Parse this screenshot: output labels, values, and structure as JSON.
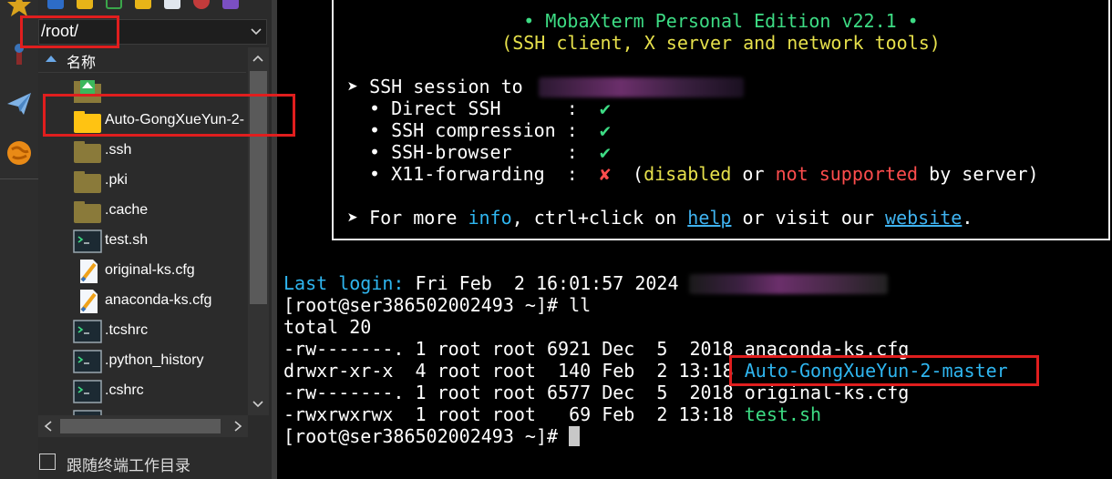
{
  "file_browser": {
    "path": "/root/",
    "column_header": "名称",
    "follow_terminal_label": "跟随终端工作目录",
    "files": [
      {
        "name": "",
        "type": "parent-folder-icon"
      },
      {
        "name": "Auto-GongXueYun-2-",
        "type": "folder-icon"
      },
      {
        "name": ".ssh",
        "type": "folder-icon"
      },
      {
        "name": ".pki",
        "type": "folder-icon"
      },
      {
        "name": ".cache",
        "type": "folder-icon"
      },
      {
        "name": "test.sh",
        "type": "script-icon"
      },
      {
        "name": "original-ks.cfg",
        "type": "config-file-icon"
      },
      {
        "name": "anaconda-ks.cfg",
        "type": "config-file-icon"
      },
      {
        "name": ".tcshrc",
        "type": "script-icon"
      },
      {
        "name": ".python_history",
        "type": "script-icon"
      },
      {
        "name": ".cshrc",
        "type": "script-icon"
      }
    ]
  },
  "banner": {
    "title_line": "• MobaXterm Personal Edition v22.1 •",
    "subtitle_line": "(SSH client, X server and network tools)",
    "session_prefix": "➤ SSH session to",
    "features": [
      {
        "label": "• Direct SSH      :",
        "mark": "✔",
        "ok": true
      },
      {
        "label": "• SSH compression :",
        "mark": "✔",
        "ok": true
      },
      {
        "label": "• SSH-browser     :",
        "mark": "✔",
        "ok": true
      },
      {
        "label": "• X11-forwarding  :",
        "mark": "✘",
        "ok": false
      }
    ],
    "x11_note": {
      "open": "(",
      "disabled": "disabled",
      "or": " or ",
      "not_supported": "not supported",
      "tail": " by server)"
    },
    "more_info": {
      "prefix": "➤ For more ",
      "info": "info",
      "mid1": ", ctrl+click on ",
      "help": "help",
      "mid2": " or visit our ",
      "website": "website",
      "end": "."
    }
  },
  "terminal": {
    "last_login_label": "Last login:",
    "last_login_value": " Fri Feb  2 16:01:57 2024",
    "prompt": "[root@ser386502002493 ~]# ",
    "command": "ll",
    "total": "total 20",
    "listing": [
      {
        "meta": "-rw-------. 1 root root 6921 Dec  5  2018 ",
        "name": "anaconda-ks.cfg",
        "kind": "plain"
      },
      {
        "meta": "drwxr-xr-x  4 root root  140 Feb  2 13:18 ",
        "name": "Auto-GongXueYun-2-master",
        "kind": "dir"
      },
      {
        "meta": "-rw-------. 1 root root 6577 Dec  5  2018 ",
        "name": "original-ks.cfg",
        "kind": "plain"
      },
      {
        "meta": "-rwxrwxrwx  1 root root   69 Feb  2 13:18 ",
        "name": "test.sh",
        "kind": "exec"
      }
    ],
    "final_prompt": "[root@ser386502002493 ~]# "
  },
  "colors": {
    "terminal_bg": "#000000",
    "green": "#3ddc84",
    "cyan": "#2fb6f0",
    "yellow": "#e6e04b",
    "red": "#ff4d4d",
    "annotation_red": "#e01e1e"
  }
}
